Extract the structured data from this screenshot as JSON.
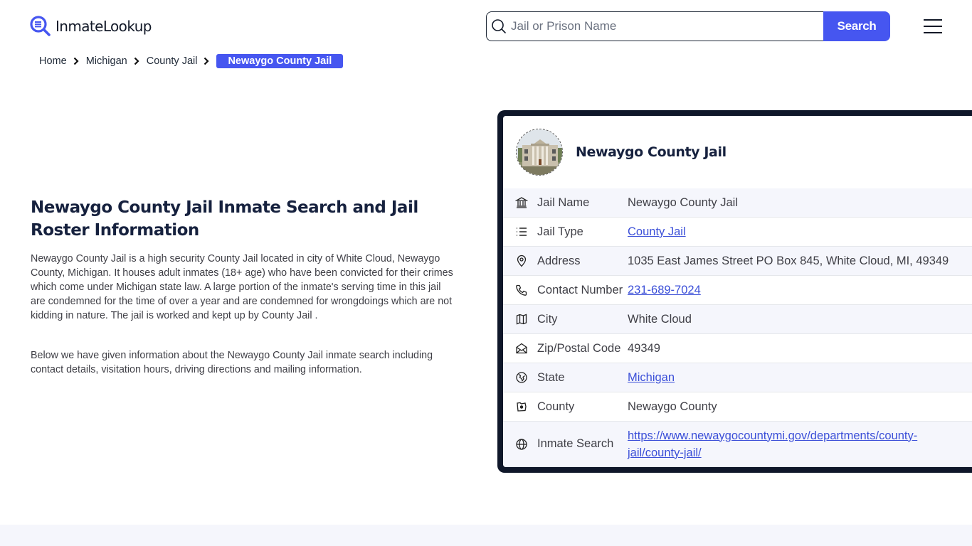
{
  "header": {
    "logo_text": "InmateLookup",
    "search": {
      "placeholder": "Jail or Prison Name",
      "value": "",
      "button_label": "Search"
    },
    "menu_icon": "hamburger-icon"
  },
  "colors": {
    "accent": "#4656f0",
    "navy": "#0f172a",
    "link": "#3b4fd8",
    "row_alt": "#f5f6fc"
  },
  "breadcrumb": [
    {
      "label": "Home"
    },
    {
      "label": "Michigan"
    },
    {
      "label": "County Jail"
    },
    {
      "label": "Newaygo County Jail",
      "active": true
    }
  ],
  "main": {
    "title": "Newaygo County Jail Inmate Search and Jail Roster Information",
    "paragraphs": [
      "Newaygo County Jail is a high security County Jail located in city of White Cloud, Newaygo County, Michigan. It houses adult inmates (18+ age) who have been convicted for their crimes which come under Michigan state law. A large portion of the inmate's serving time in this jail are condemned for the time of over a year and are condemned for wrongdoings which are not kidding in nature. The jail is worked and kept up by County Jail .",
      "Below we have given information about the Newaygo County Jail inmate search including contact details, visitation hours, driving directions and mailing information."
    ]
  },
  "card": {
    "title": "Newaygo County Jail",
    "rows": [
      {
        "icon": "bank-icon",
        "label": "Jail Name",
        "value": "Newaygo County Jail",
        "link": false
      },
      {
        "icon": "list-icon",
        "label": "Jail Type",
        "value": "County Jail",
        "link": true
      },
      {
        "icon": "map-pin-icon",
        "label": "Address",
        "value": "1035 East James Street PO Box 845, White Cloud, MI, 49349",
        "link": false
      },
      {
        "icon": "phone-icon",
        "label": "Contact Number",
        "value": "231-689-7024",
        "link": true
      },
      {
        "icon": "map-icon",
        "label": "City",
        "value": "White Cloud",
        "link": false
      },
      {
        "icon": "mail-open-icon",
        "label": "Zip/Postal Code",
        "value": "49349",
        "link": false
      },
      {
        "icon": "globe-pin-icon",
        "label": "State",
        "value": "Michigan",
        "link": true
      },
      {
        "icon": "county-map-icon",
        "label": "County",
        "value": "Newaygo County",
        "link": false
      },
      {
        "icon": "globe-icon",
        "label": "Inmate Search",
        "value": "https://www.newaygocountymi.gov/departments/county-jail/county-jail/",
        "link": true
      }
    ]
  }
}
